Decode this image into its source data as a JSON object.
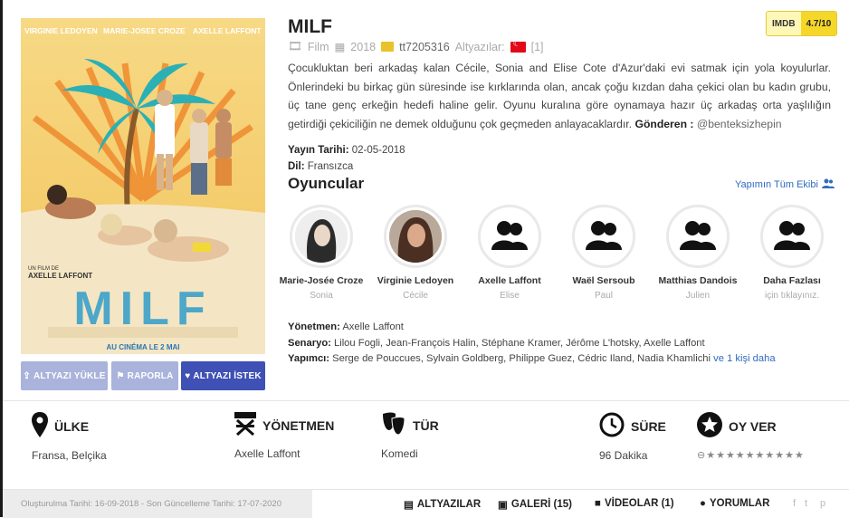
{
  "movie": {
    "title": "MILF",
    "imdb_label": "IMDB",
    "imdb_rating": "4.7/10",
    "type": "Film",
    "year": "2018",
    "imdb_id": "tt7205316",
    "subtitles_label": "Altyazılar:",
    "subtitles_count": "[1]",
    "summary": "Çocukluktan beri arkadaş kalan Cécile, Sonia and Elise Cote d'Azur'daki evi satmak için yola koyulurlar. Önlerindeki bu birkaç gün süresinde ise kırklarında olan, ancak çoğu kızdan daha çekici olan bu kadın grubu, üç tane genç erkeğin hedefi haline gelir. Oyunu kuralına göre oynamaya hazır üç arkadaş orta yaşlılığın getirdiği çekiciliğin ne demek olduğunu çok geçmeden anlayacaklardır.",
    "sender_label": "Gönderen :",
    "sender": "@benteksizhepin",
    "release_label": "Yayın Tarihi:",
    "release_date": "02-05-2018",
    "language_label": "Dil:",
    "language": "Fransızca"
  },
  "poster": {
    "cast_line": [
      "VIRGINIE LEDOYEN",
      "MARIE-JOSEE CROZE",
      "AXELLE LAFFONT"
    ],
    "un_film_de": "UN FILM DE",
    "director": "AXELLE LAFFONT",
    "big_title": "MILF",
    "release": "AU CINÉMA LE 2 MAI"
  },
  "buttons": {
    "upload": "ALTYAZI YÜKLE",
    "report": "RAPORLA",
    "request": "ALTYAZI İSTEK"
  },
  "cast_section": {
    "title": "Oyuncular",
    "crew_link": "Yapımın Tüm Ekibi",
    "members": [
      {
        "name": "Marie-Josée Croze",
        "role": "Sonia"
      },
      {
        "name": "Virginie Ledoyen",
        "role": "Cécile"
      },
      {
        "name": "Axelle Laffont",
        "role": "Elise"
      },
      {
        "name": "Waël Sersoub",
        "role": "Paul"
      },
      {
        "name": "Matthias Dandois",
        "role": "Julien"
      },
      {
        "name": "Daha Fazlası",
        "role": "için tıklayınız."
      }
    ]
  },
  "crew": {
    "director_label": "Yönetmen:",
    "director": "Axelle Laffont",
    "writers_label": "Senaryo:",
    "writers": "Lilou Fogli, Jean-François Halin, Stéphane Kramer, Jérôme L'hotsky, Axelle Laffont",
    "producers_label": "Yapımcı:",
    "producers": "Serge de Pouccues, Sylvain Goldberg, Philippe Guez, Cédric Iland, Nadia Khamlichi",
    "producers_more": "ve 1 kişi daha"
  },
  "stats": {
    "country_label": "ÜLKE",
    "country": "Fransa, Belçika",
    "director_label": "YÖNETMEN",
    "director": "Axelle Laffont",
    "genre_label": "TÜR",
    "genre": "Komedi",
    "duration_label": "SÜRE",
    "duration": "96 Dakika",
    "vote_label": "OY VER",
    "vote_stars": "★★★★★★★★★★"
  },
  "footer": {
    "dates": "Oluşturulma Tarihi: 16-09-2018 - Son Güncelleme Tarihi: 17-07-2020",
    "tab_subtitles": "ALTYAZILAR",
    "tab_gallery": "GALERİ (15)",
    "tab_videos": "VİDEOLAR (1)",
    "tab_comments": "YORUMLAR"
  },
  "colors": {
    "accent": "#3f51b5",
    "accent_light": "#a9b3dc",
    "link": "#2f6bbf",
    "imdb_yellow": "#f5d72a"
  }
}
